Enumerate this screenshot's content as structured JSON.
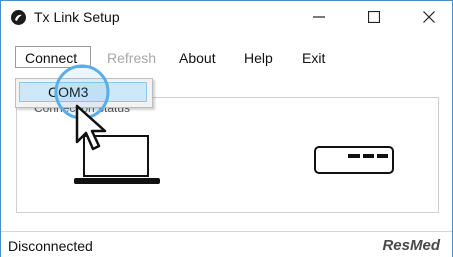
{
  "window": {
    "title": "Tx Link Setup",
    "controls": {
      "minimize": "minimize",
      "maximize": "maximize",
      "close": "close"
    }
  },
  "menu": {
    "items": [
      {
        "label": "Connect",
        "enabled": true,
        "open": true
      },
      {
        "label": "Refresh",
        "enabled": false
      },
      {
        "label": "About",
        "enabled": true
      },
      {
        "label": "Help",
        "enabled": true
      },
      {
        "label": "Exit",
        "enabled": true
      }
    ],
    "connect_dropdown": [
      {
        "label": "COM3",
        "highlighted": true
      }
    ]
  },
  "connection_group": {
    "label": "Connection status",
    "left_device_icon": "laptop-icon",
    "right_device_icon": "device-icon"
  },
  "statusbar": {
    "status": "Disconnected",
    "brand": "ResMed"
  },
  "colors": {
    "window_border": "#4a90c8",
    "menu_highlight": "#cde8f8",
    "click_highlight": "#5aaee6",
    "disabled_text": "#a8a8a8"
  }
}
